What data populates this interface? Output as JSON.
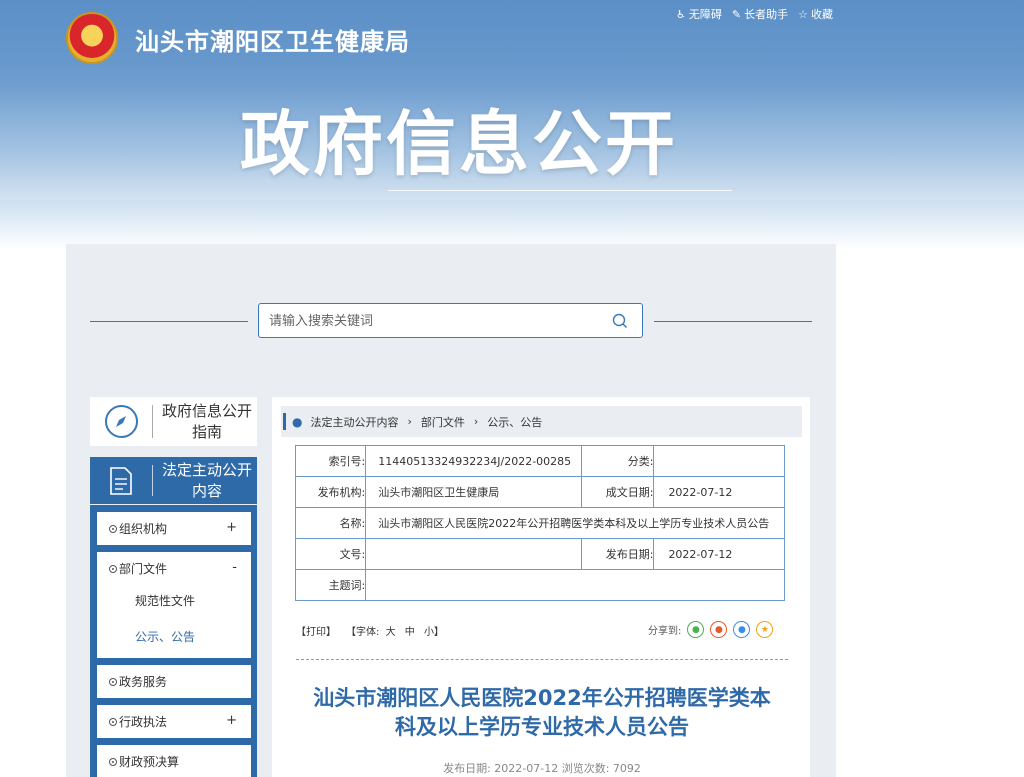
{
  "header": {
    "site_title": "汕头市潮阳区卫生健康局",
    "banner_title": "政府信息公开",
    "top_links": [
      {
        "label": "无障碍",
        "icon": "accessibility-icon"
      },
      {
        "label": "长者助手",
        "icon": "elder-helper-icon"
      },
      {
        "label": "收藏",
        "icon": "star-icon"
      }
    ]
  },
  "search": {
    "placeholder": "请输入搜索关键词"
  },
  "sidebar": {
    "guide_label": "政府信息公开指南",
    "active_label": "法定主动公开内容",
    "items": [
      {
        "label": "组织机构",
        "toggle": "+"
      },
      {
        "label": "部门文件",
        "toggle": "-",
        "subitems": [
          "规范性文件",
          "公示、公告"
        ]
      },
      {
        "label": "政务服务",
        "toggle": ""
      },
      {
        "label": "行政执法",
        "toggle": "+"
      },
      {
        "label": "财政预决算",
        "toggle": ""
      }
    ]
  },
  "breadcrumb": [
    "法定主动公开内容",
    "部门文件",
    "公示、公告"
  ],
  "meta": {
    "index_label": "索引号:",
    "index_value": "11440513324932234J/2022-00285",
    "category_label": "分类:",
    "category_value": "",
    "org_label": "发布机构:",
    "org_value": "汕头市潮阳区卫生健康局",
    "created_label": "成文日期:",
    "created_value": "2022-07-12",
    "name_label": "名称:",
    "name_value": "汕头市潮阳区人民医院2022年公开招聘医学类本科及以上学历专业技术人员公告",
    "docno_label": "文号:",
    "docno_value": "",
    "published_label": "发布日期:",
    "published_value": "2022-07-12",
    "subject_label": "主题词:",
    "subject_value": ""
  },
  "tools": {
    "print": "【打印】",
    "font_prefix": "【字体:",
    "font_large": "大",
    "font_medium": "中",
    "font_small": "小】",
    "share_label": "分享到:"
  },
  "article": {
    "title_line1": "汕头市潮阳区人民医院2022年公开招聘医学类本",
    "title_line2": "科及以上学历专业技术人员公告",
    "pub_info": "发布日期: 2022-07-12  浏览次数: 7092"
  }
}
